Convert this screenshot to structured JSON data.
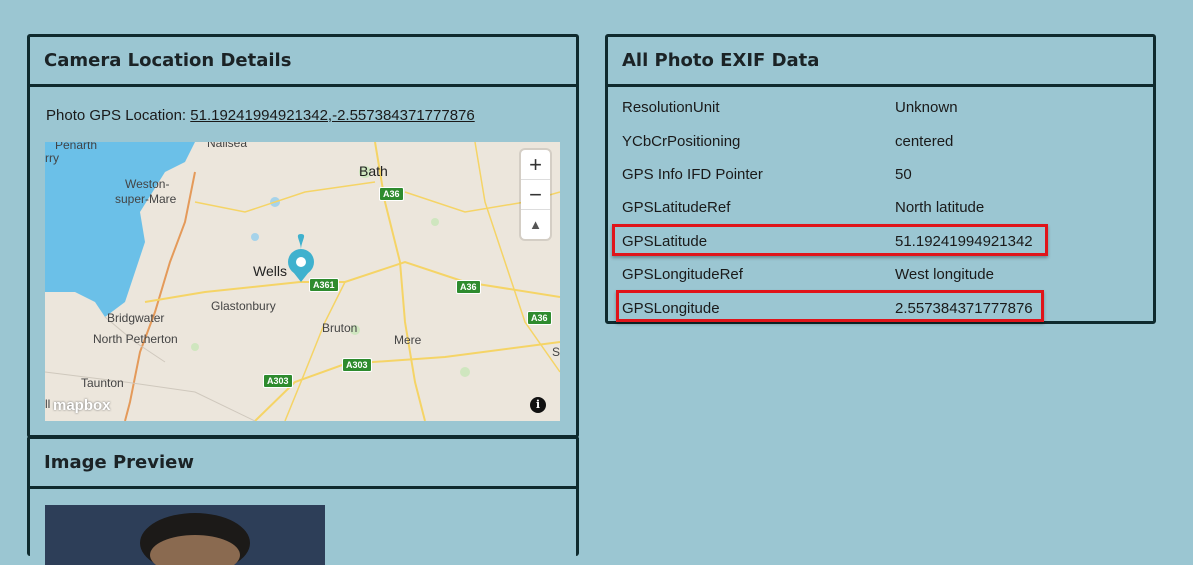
{
  "location_panel": {
    "title": "Camera Location Details",
    "gps_label": "Photo GPS Location:",
    "gps_value": "51.19241994921342,-2.557384371777876"
  },
  "map": {
    "zoom_in": "+",
    "zoom_out": "−",
    "compass": "▲",
    "info": "i",
    "logo": "mapbox",
    "places": [
      "Penarth",
      "Nailsea",
      "Bath",
      "Weston-",
      "super-Mare",
      "Wells",
      "Glastonbury",
      "Bridgwater",
      "North Petherton",
      "Bruton",
      "Mere",
      "Taunton",
      "S",
      "rry",
      "ll"
    ],
    "roads": [
      "A36",
      "A361",
      "A36",
      "A36",
      "A303",
      "A303"
    ]
  },
  "preview_panel": {
    "title": "Image Preview"
  },
  "exif_panel": {
    "title": "All Photo EXIF Data",
    "rows": [
      {
        "key": "ResolutionUnit",
        "value": "Unknown"
      },
      {
        "key": "YCbCrPositioning",
        "value": "centered"
      },
      {
        "key": "GPS Info IFD Pointer",
        "value": "50"
      },
      {
        "key": "GPSLatitudeRef",
        "value": "North latitude"
      },
      {
        "key": "GPSLatitude",
        "value": "51.19241994921342"
      },
      {
        "key": "GPSLongitudeRef",
        "value": "West longitude"
      },
      {
        "key": "GPSLongitude",
        "value": "2.557384371777876"
      }
    ]
  },
  "colors": {
    "background": "#9bc6d2",
    "border": "#0f2a2e",
    "highlight": "#e0141a",
    "marker": "#3fb1ce"
  }
}
